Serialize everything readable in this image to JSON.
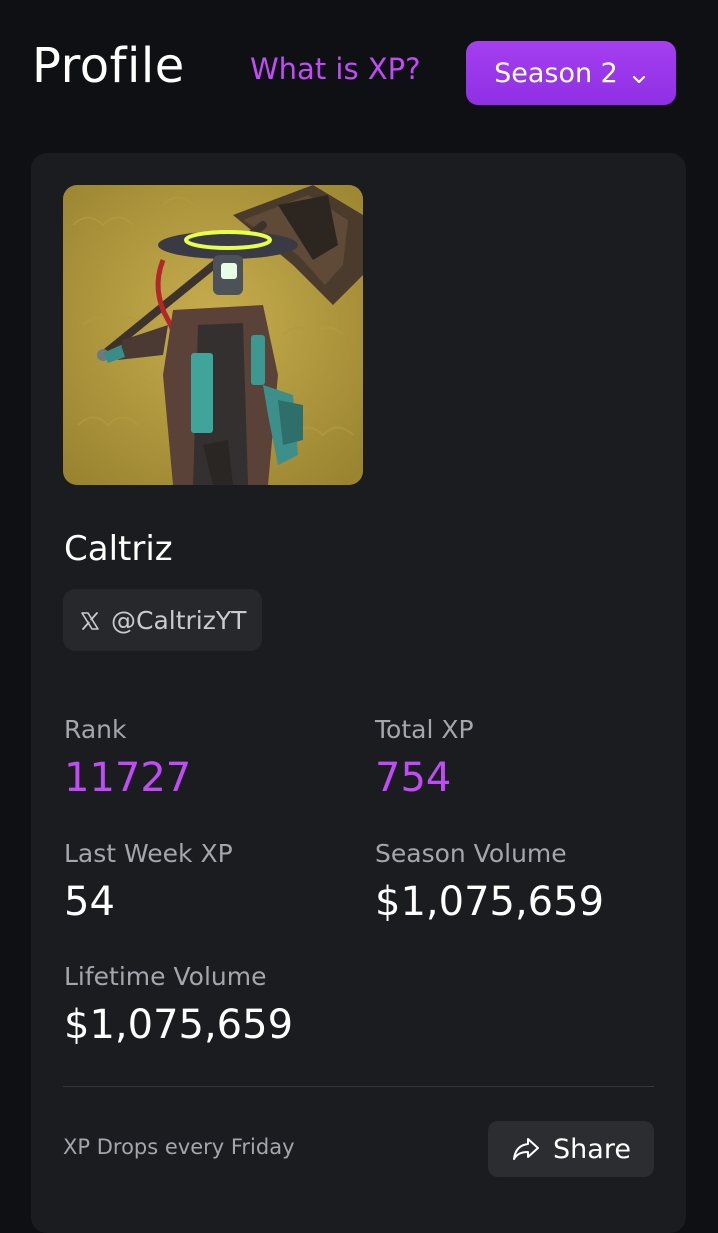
{
  "header": {
    "title": "Profile",
    "xp_link": "What is XP?",
    "season_selector": {
      "selected": "Season 2",
      "icon": "chevron-down-icon"
    }
  },
  "profile": {
    "display_name": "Caltriz",
    "handle": "@CaltrizYT",
    "handle_icon": "x-logo-icon",
    "avatar": "nft-character-avatar"
  },
  "stats": {
    "rank_label": "Rank",
    "rank_value": "11727",
    "total_xp_label": "Total XP",
    "total_xp_value": "754",
    "last_week_xp_label": "Last Week XP",
    "last_week_xp_value": "54",
    "season_volume_label": "Season Volume",
    "season_volume_value": "$1,075,659",
    "lifetime_volume_label": "Lifetime Volume",
    "lifetime_volume_value": "$1,075,659"
  },
  "footer": {
    "note": "XP Drops every Friday",
    "share_label": "Share",
    "share_icon": "share-arrow-icon"
  },
  "colors": {
    "background": "#0f1013",
    "card": "#1a1c1f",
    "accent": "#c14bf7",
    "button_purple": "#9a36ea"
  }
}
